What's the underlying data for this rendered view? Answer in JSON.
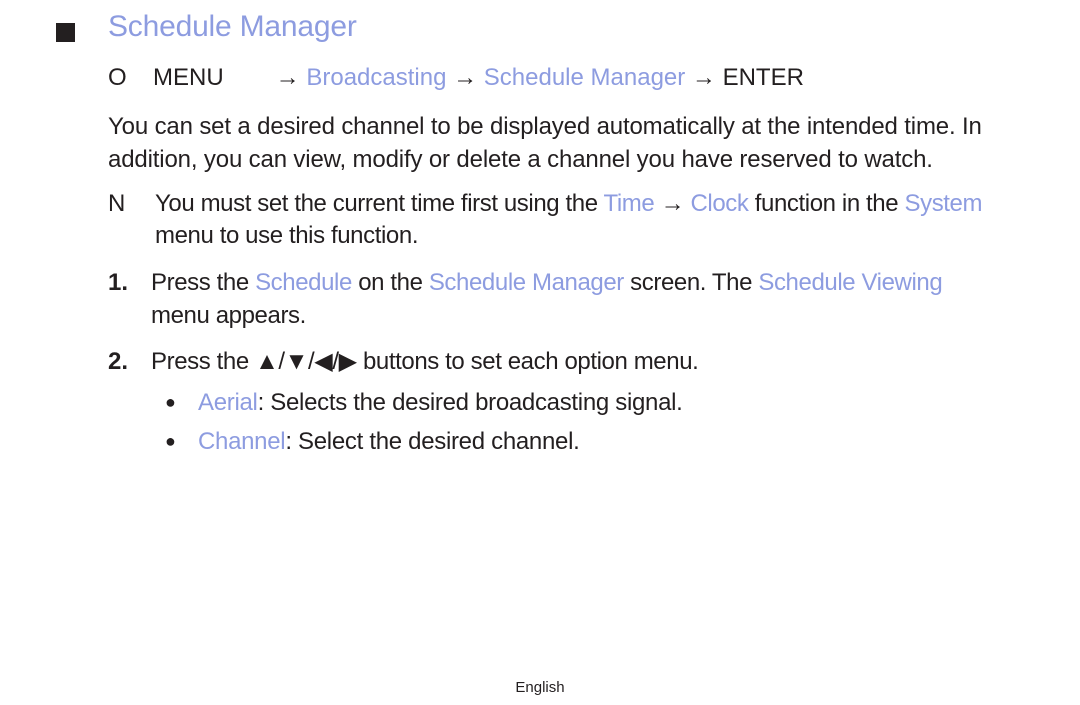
{
  "page": {
    "title": "Schedule Manager",
    "path": {
      "marker": "O",
      "menu": "MENU",
      "arrow1": " → ",
      "broadcasting": "Broadcasting",
      "arrow2": " → ",
      "schedule_manager": "Schedule Manager",
      "arrow3": " → ",
      "enter": "ENTER"
    },
    "intro": "You can set a desired channel to be displayed automatically at the intended time. In addition, you can view, modify or delete a channel you have reserved to watch.",
    "note": {
      "marker": "N",
      "t1": "You must set the current time first using the ",
      "time": "Time",
      "arrow": " → ",
      "clock": "Clock",
      "t2": " function in the ",
      "system": "System",
      "t3": " menu to use this function."
    },
    "steps": [
      {
        "num": "1.",
        "t1": "Press the ",
        "h1": "Schedule",
        "t2": " on the ",
        "h2": "Schedule Manager",
        "t3": " screen. The ",
        "h3": "Schedule Viewing",
        "t4": " menu appears."
      },
      {
        "num": "2.",
        "t1": "Press the ",
        "buttons": "▲/▼/◀/▶",
        "t2": " buttons to set each option menu."
      }
    ],
    "bullets": [
      {
        "dot": "●",
        "term": "Aerial",
        "desc": ": Selects the desired broadcasting signal."
      },
      {
        "dot": "●",
        "term": "Channel",
        "desc": ": Select the desired channel."
      }
    ],
    "footer": "English"
  },
  "colors": {
    "highlight": "#8d9ce0",
    "text": "#231f20"
  }
}
